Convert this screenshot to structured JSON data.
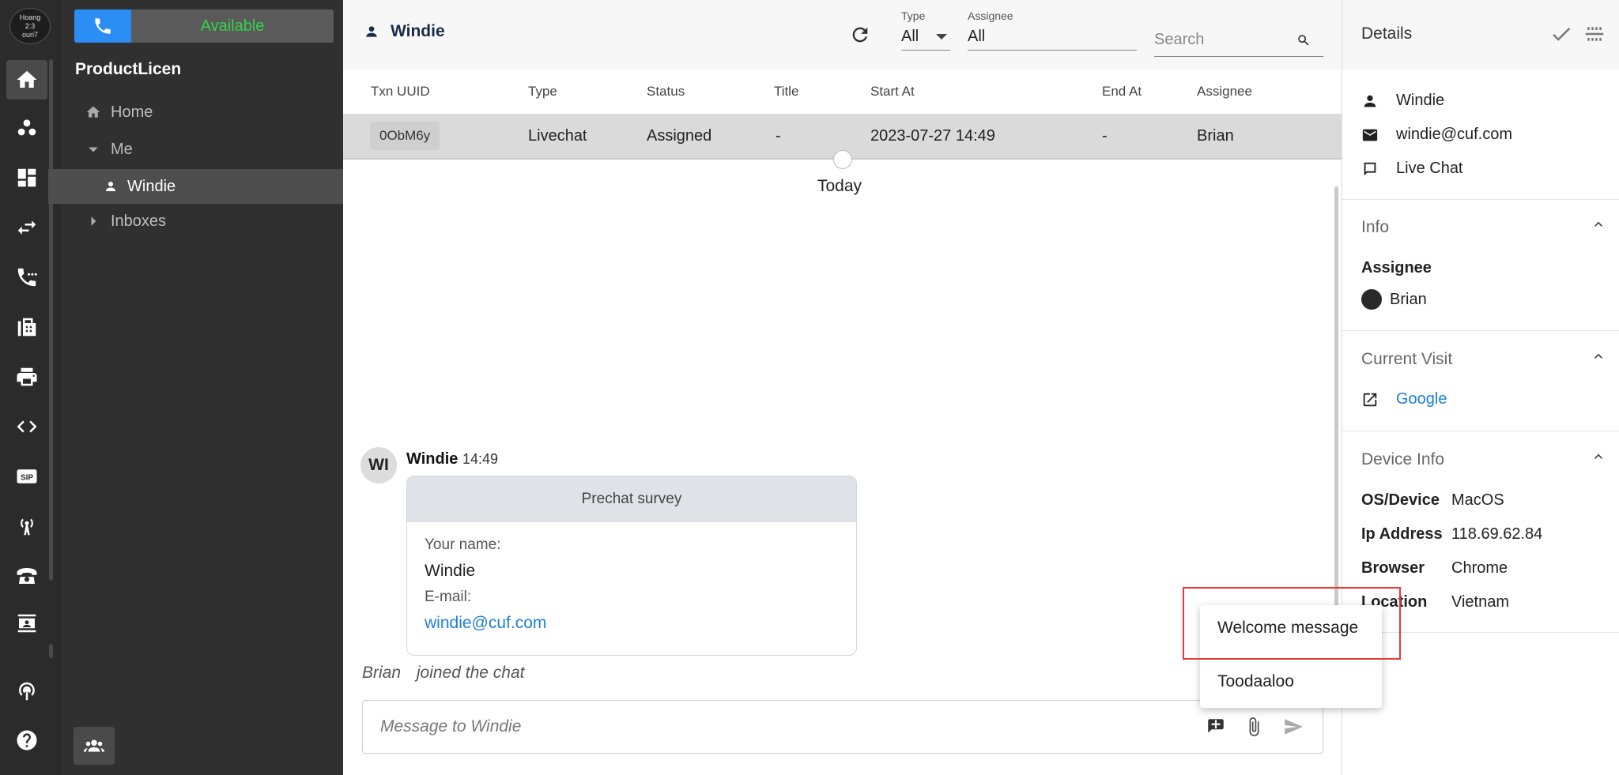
{
  "rail": {
    "avatar_line1": "Hoang",
    "avatar_line2": "2:3",
    "avatar_line3": "ouri7",
    "icons": [
      "home-icon",
      "group-icon",
      "dashboard-icon",
      "transfer-icon",
      "call-log-icon",
      "fax-icon",
      "printer-icon",
      "code-icon",
      "sip-icon",
      "broadcast-icon",
      "phone-icon",
      "contact-card-icon",
      "antenna-icon",
      "help-icon"
    ]
  },
  "nav": {
    "status": "Available",
    "org_name": "ProductLicen",
    "items": [
      {
        "label": "Home"
      },
      {
        "label": "Me"
      },
      {
        "label": "Windie"
      },
      {
        "label": "Inboxes"
      }
    ]
  },
  "header": {
    "person": "Windie",
    "type_label": "Type",
    "type_value": "All",
    "assignee_label": "Assignee",
    "assignee_value": "All",
    "search_placeholder": "Search"
  },
  "table": {
    "columns": [
      "Txn UUID",
      "Type",
      "Status",
      "Title",
      "Start At",
      "End At",
      "Assignee"
    ],
    "rows": [
      {
        "uuid": "0ObM6y",
        "type": "Livechat",
        "status": "Assigned",
        "title": "-",
        "start": "2023-07-27 14:49",
        "end": "-",
        "assignee": "Brian"
      }
    ]
  },
  "chat": {
    "day_label": "Today",
    "avatar_initials": "WI",
    "sender": "Windie",
    "time": "14:49",
    "survey_title": "Prechat survey",
    "name_label": "Your name:",
    "name_value": "Windie",
    "email_label": "E-mail:",
    "email_value": "windie@cuf.com",
    "joined_who": "Brian",
    "joined_text": "joined the chat",
    "composer_placeholder": "Message to Windie"
  },
  "canned_menu": {
    "items": [
      "Welcome message",
      "Toodaaloo"
    ]
  },
  "details": {
    "title": "Details",
    "name": "Windie",
    "email": "windie@cuf.com",
    "channel": "Live Chat",
    "info_title": "Info",
    "assignee_label": "Assignee",
    "assignee_value": "Brian",
    "visit_title": "Current Visit",
    "visit_link": "Google",
    "device_title": "Device Info",
    "os_label": "OS/Device",
    "os_value": "MacOS",
    "ip_label": "Ip Address",
    "ip_value": "118.69.62.84",
    "browser_label": "Browser",
    "browser_value": "Chrome",
    "location_label": "Location",
    "location_value": "Vietnam"
  },
  "colors": {
    "accent_blue": "#2a8ef5",
    "available_green": "#35d24a",
    "link_blue": "#1d7fd6",
    "highlight_red": "#e53935"
  }
}
